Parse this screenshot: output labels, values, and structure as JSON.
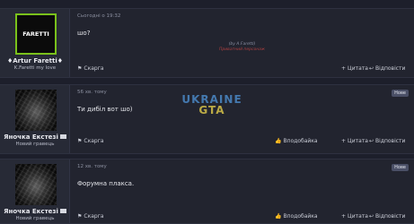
{
  "posts": [
    {
      "author": {
        "avatar_text": "FARETTI",
        "name": "♦Artur Faretti♦",
        "title": "K.Faretti my love"
      },
      "timestamp": "Сьогодні о 19:32",
      "content": "шо?",
      "actions": {
        "report": "Скарга",
        "quote": "Цитата",
        "reply": "Відповісти"
      }
    },
    {
      "author": {
        "name": "Яночка Екстезі",
        "title": "Новий гравець"
      },
      "timestamp": "56 хв. тому",
      "badge": "Нове",
      "content": "Ти дибіл вот шо)",
      "actions": {
        "report": "Скарга",
        "like": "Вподобайка",
        "quote": "Цитата",
        "reply": "Відповісти"
      }
    },
    {
      "author": {
        "name": "Яночка Екстезі",
        "title": "Новий гравець"
      },
      "timestamp": "12 хв. тому",
      "badge": "Нове",
      "content": "Форумна плакса.",
      "actions": {
        "report": "Скарга",
        "like": "Вподобайка",
        "quote": "Цитата",
        "reply": "Відповісти"
      }
    }
  ],
  "watermarks": {
    "signature_line1": "(by A.Faretti)",
    "signature_line2": "Приватний персонаж",
    "logo_line1": "UKRAINE",
    "logo_line2": "GTA"
  },
  "colors": {
    "background": "#1d1f2b",
    "post": "#22242f",
    "avatar_border": "#7ac11b",
    "badge": "#4a4f66"
  },
  "icons": [
    "flag-icon",
    "plus-icon",
    "reply-icon",
    "thumbs-up-icon",
    "envelope-icon"
  ]
}
